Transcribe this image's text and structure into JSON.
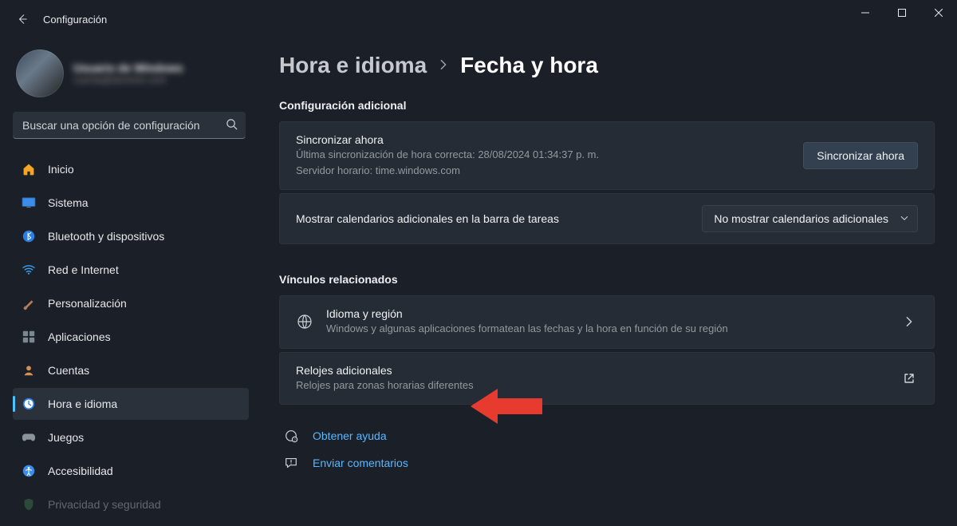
{
  "app": {
    "title": "Configuración"
  },
  "profile": {
    "name": "Usuario de Windows",
    "email": "cuenta@dominio.com"
  },
  "search": {
    "placeholder": "Buscar una opción de configuración"
  },
  "sidebar": {
    "items": [
      {
        "label": "Inicio"
      },
      {
        "label": "Sistema"
      },
      {
        "label": "Bluetooth y dispositivos"
      },
      {
        "label": "Red e Internet"
      },
      {
        "label": "Personalización"
      },
      {
        "label": "Aplicaciones"
      },
      {
        "label": "Cuentas"
      },
      {
        "label": "Hora e idioma"
      },
      {
        "label": "Juegos"
      },
      {
        "label": "Accesibilidad"
      },
      {
        "label": "Privacidad y seguridad"
      }
    ]
  },
  "breadcrumb": {
    "parent": "Hora e idioma",
    "current": "Fecha y hora"
  },
  "sections": {
    "additional_config": "Configuración adicional",
    "related_links": "Vínculos relacionados"
  },
  "sync": {
    "title": "Sincronizar ahora",
    "last_line": "Última sincronización de hora correcta: 28/08/2024 01:34:37 p. m.",
    "server_line": "Servidor horario: time.windows.com",
    "button": "Sincronizar ahora"
  },
  "calendars": {
    "title": "Mostrar calendarios adicionales en la barra de tareas",
    "selected": "No mostrar calendarios adicionales"
  },
  "link_language": {
    "title": "Idioma y región",
    "sub": "Windows y algunas aplicaciones formatean las fechas y la hora en función de su región"
  },
  "link_clocks": {
    "title": "Relojes adicionales",
    "sub": "Relojes para zonas horarias diferentes"
  },
  "help": {
    "label": "Obtener ayuda"
  },
  "feedback": {
    "label": "Enviar comentarios"
  }
}
